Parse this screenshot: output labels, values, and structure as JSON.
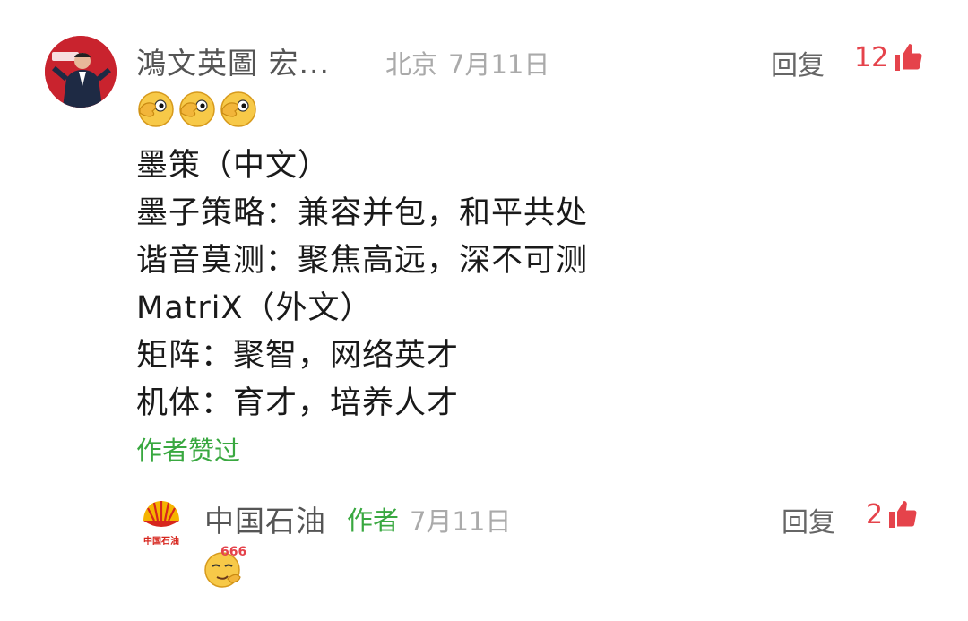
{
  "comment": {
    "author": "鴻文英圖 宏...",
    "location": "北京",
    "date": "7月11日",
    "reply_label": "回复",
    "like_count": "12",
    "emoji_icons": [
      "eye-peek-emoji-icon",
      "eye-peek-emoji-icon",
      "eye-peek-emoji-icon"
    ],
    "lines": [
      "墨策（中文）",
      "墨子策略：兼容并包，和平共处",
      "谐音莫测：聚焦高远，深不可测",
      "MatriX（外文）",
      "矩阵：聚智，网络英才",
      "机体：育才，培养人才"
    ],
    "author_liked": "作者赞过"
  },
  "reply": {
    "author": "中国石油",
    "logo_text": "中国石油",
    "author_badge": "作者",
    "date": "7月11日",
    "reply_label": "回复",
    "like_count": "2",
    "emoji_icon": "666-emoji-icon",
    "emoji_text": "666"
  },
  "colors": {
    "like_red": "#e5434b",
    "author_green": "#39a840",
    "meta_gray": "#aaaaaa",
    "logo_yellow": "#f5b400",
    "logo_red": "#d7261e"
  }
}
